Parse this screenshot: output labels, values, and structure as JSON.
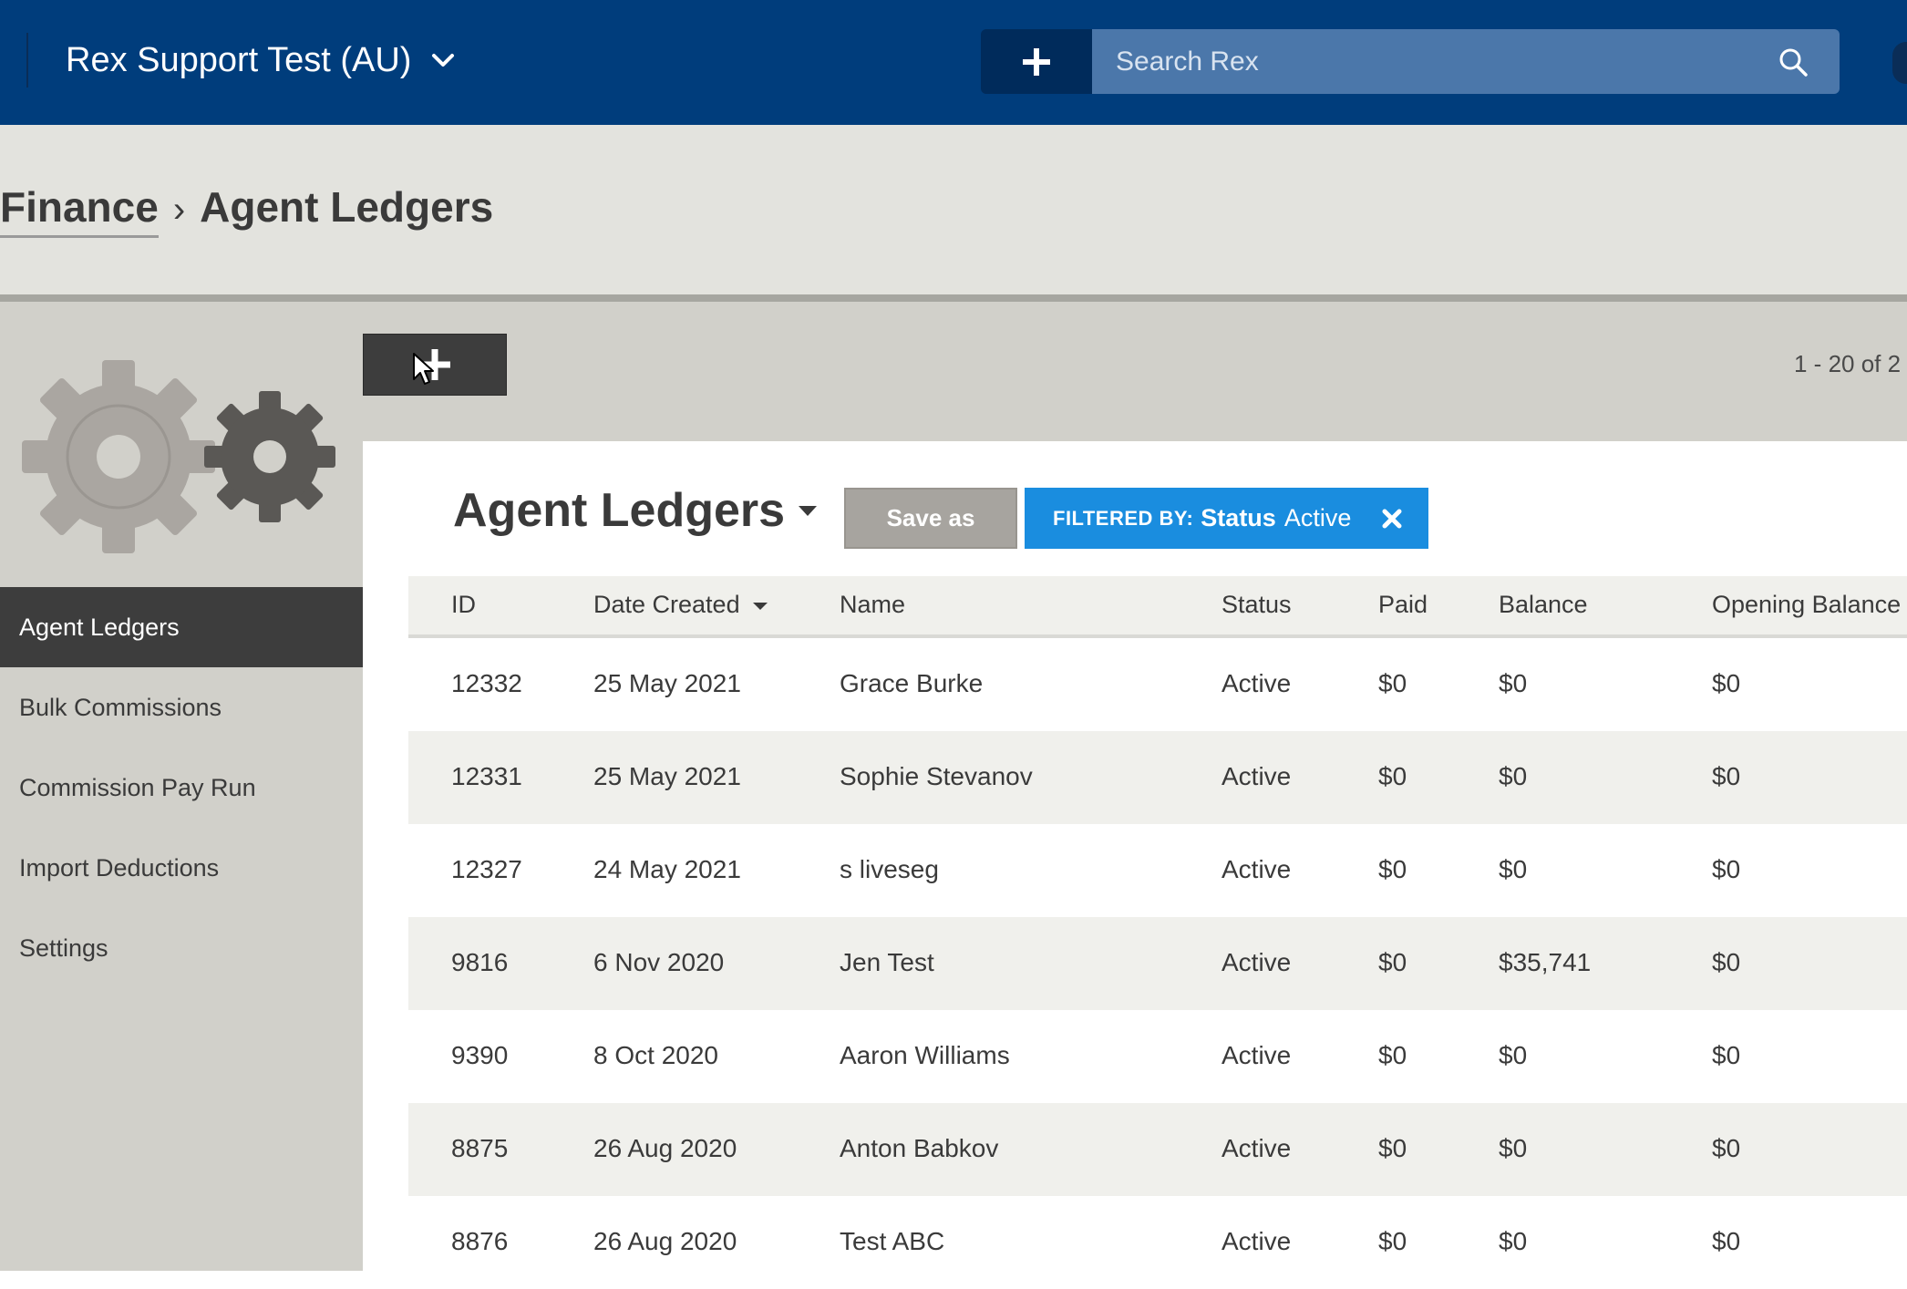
{
  "header": {
    "account_name": "Rex Support Test (AU)",
    "search_placeholder": "Search Rex"
  },
  "breadcrumb": {
    "parent": "Finance",
    "separator": "›",
    "current": "Agent Ledgers"
  },
  "sidebar": {
    "items": [
      {
        "label": "Agent Ledgers",
        "active": true
      },
      {
        "label": "Bulk Commissions",
        "active": false
      },
      {
        "label": "Commission Pay Run",
        "active": false
      },
      {
        "label": "Import Deductions",
        "active": false
      },
      {
        "label": "Settings",
        "active": false
      }
    ]
  },
  "toolbar": {
    "pagination": "1 - 20 of 2"
  },
  "list": {
    "title": "Agent Ledgers",
    "save_as_label": "Save as",
    "filter": {
      "prefix": "FILTERED BY:",
      "field": "Status",
      "value": "Active"
    }
  },
  "table": {
    "columns": [
      "ID",
      "Date Created",
      "Name",
      "Status",
      "Paid",
      "Balance",
      "Opening Balance"
    ],
    "rows": [
      {
        "id": "12332",
        "date": "25 May 2021",
        "name": "Grace Burke",
        "status": "Active",
        "paid": "$0",
        "balance": "$0",
        "opening": "$0"
      },
      {
        "id": "12331",
        "date": "25 May 2021",
        "name": "Sophie Stevanov",
        "status": "Active",
        "paid": "$0",
        "balance": "$0",
        "opening": "$0"
      },
      {
        "id": "12327",
        "date": "24 May 2021",
        "name": "s liveseg",
        "status": "Active",
        "paid": "$0",
        "balance": "$0",
        "opening": "$0"
      },
      {
        "id": "9816",
        "date": "6 Nov 2020",
        "name": "Jen Test",
        "status": "Active",
        "paid": "$0",
        "balance": "$35,741",
        "opening": "$0"
      },
      {
        "id": "9390",
        "date": "8 Oct 2020",
        "name": "Aaron Williams",
        "status": "Active",
        "paid": "$0",
        "balance": "$0",
        "opening": "$0"
      },
      {
        "id": "8875",
        "date": "26 Aug 2020",
        "name": "Anton Babkov",
        "status": "Active",
        "paid": "$0",
        "balance": "$0",
        "opening": "$0"
      },
      {
        "id": "8876",
        "date": "26 Aug 2020",
        "name": "Test ABC",
        "status": "Active",
        "paid": "$0",
        "balance": "$0",
        "opening": "$0"
      }
    ]
  },
  "colors": {
    "topbar": "#003d7c",
    "search_bg": "#4b77aa",
    "filter_chip": "#1a8ddf",
    "sidebar_active": "#3d3d3d"
  },
  "icons": {
    "account_menu": "chevron-down-icon",
    "quick_add": "plus-icon",
    "search": "search-icon",
    "new_ledger": "plus-icon",
    "filter_remove": "close-icon",
    "title_menu": "caret-down-icon",
    "sort": "sort-desc-icon"
  }
}
